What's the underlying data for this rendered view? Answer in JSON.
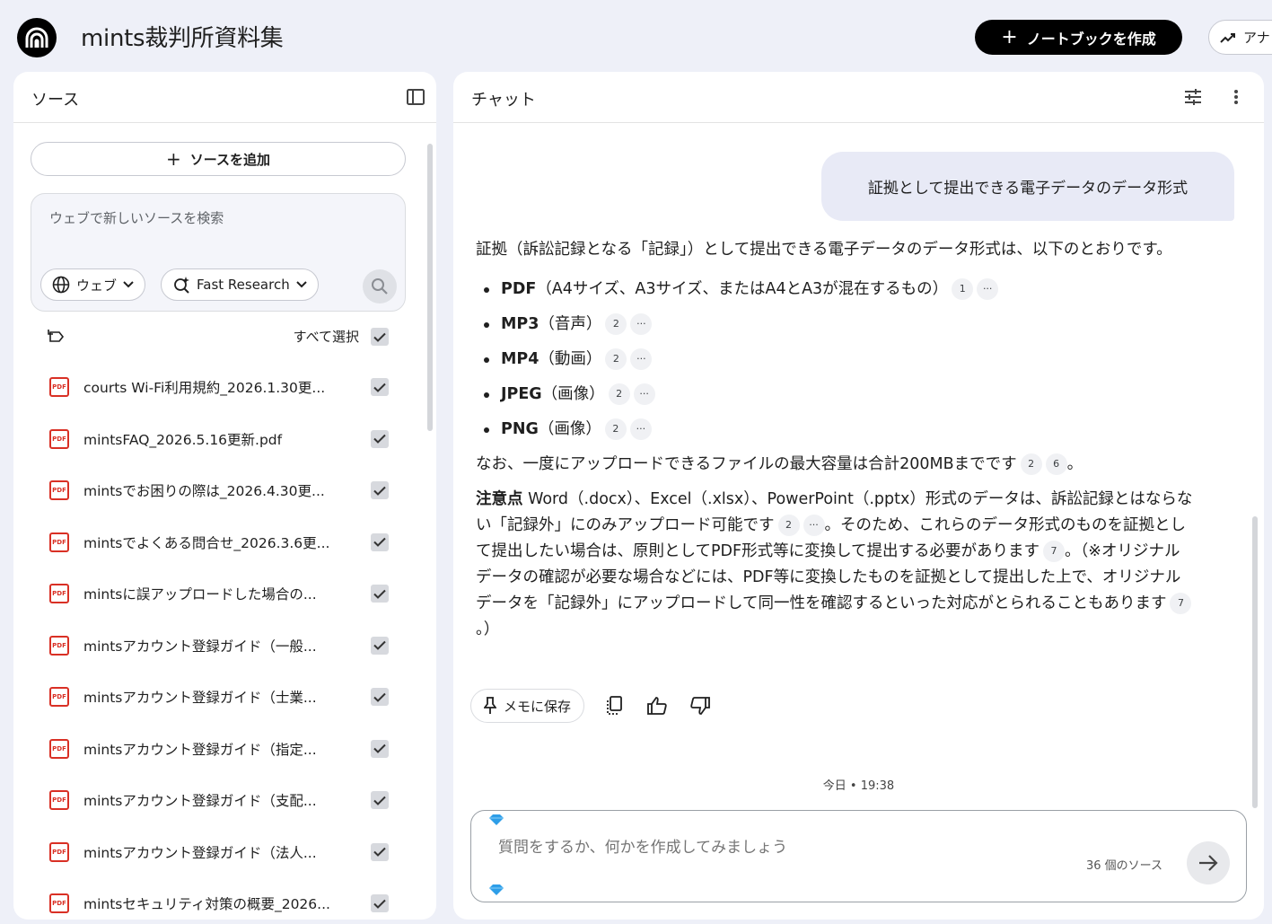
{
  "header": {
    "app_title": "mints裁判所資料集",
    "create_button": "ノートブックを作成",
    "analytics_button": "アナ"
  },
  "sources": {
    "title": "ソース",
    "add_button": "ソースを追加",
    "search_placeholder": "ウェブで新しいソースを検索",
    "web_chip": "ウェブ",
    "research_chip": "Fast Research",
    "select_all": "すべて選択",
    "items": [
      {
        "name": "courts Wi-Fi利用規約_2026.1.30更...",
        "icon": "PDF"
      },
      {
        "name": "mintsFAQ_2026.5.16更新.pdf",
        "icon": "PDF"
      },
      {
        "name": "mintsでお困りの際は_2026.4.30更...",
        "icon": "PDF"
      },
      {
        "name": "mintsでよくある問合せ_2026.3.6更...",
        "icon": "PDF"
      },
      {
        "name": "mintsに誤アップロードした場合の...",
        "icon": "PDF"
      },
      {
        "name": "mintsアカウント登録ガイド（一般...",
        "icon": "PDF"
      },
      {
        "name": "mintsアカウント登録ガイド（士業...",
        "icon": "PDF"
      },
      {
        "name": "mintsアカウント登録ガイド（指定...",
        "icon": "PDF"
      },
      {
        "name": "mintsアカウント登録ガイド（支配...",
        "icon": "PDF"
      },
      {
        "name": "mintsアカウント登録ガイド（法人...",
        "icon": "PDF"
      },
      {
        "name": "mintsセキュリティ対策の概要_2026...",
        "icon": "PDF"
      }
    ]
  },
  "chat": {
    "title": "チャット",
    "user_message": "証拠として提出できる電子データのデータ形式",
    "answer_intro": "証拠（訴訟記録となる「記録」）として提出できる電子データのデータ形式は、以下のとおりです。",
    "formats": [
      {
        "name": "PDF",
        "detail": "（A4サイズ、A3サイズ、またはA4とA3が混在するもの）",
        "cite": "1"
      },
      {
        "name": "MP3",
        "detail": "（音声）",
        "cite": "2"
      },
      {
        "name": "MP4",
        "detail": "（動画）",
        "cite": "2"
      },
      {
        "name": "JPEG",
        "detail": "（画像）",
        "cite": "2"
      },
      {
        "name": "PNG",
        "detail": "（画像）",
        "cite": "2"
      }
    ],
    "more_cite": "···",
    "capacity_text": "なお、一度にアップロードできるファイルの最大容量は合計200MBまでです",
    "capacity_cite_1": "2",
    "capacity_cite_2": "6",
    "period": "。",
    "note_label": "注意点",
    "note_text_1": " Word（.docx）、Excel（.xlsx）、PowerPoint（.pptx）形式のデータは、訴訟記録とはならない「記録外」にのみアップロード可能です",
    "note_cite_1": "2",
    "note_text_2": "。そのため、これらのデータ形式のものを証拠として提出したい場合は、原則としてPDF形式等に変換して提出する必要があります",
    "note_cite_2": "7",
    "note_text_3": "。（※オリジナルデータの確認が必要な場合などには、PDF等に変換したものを証拠として提出した上で、オリジナルデータを「記録外」にアップロードして同一性を確認するといった対応がとられることもあります",
    "note_cite_3": "7",
    "note_end": "。）",
    "save_memo": "メモに保存",
    "timestamp": "今日 • 19:38",
    "input_placeholder": "質問をするか、何かを作成してみましょう",
    "source_count": "36 個のソース"
  }
}
